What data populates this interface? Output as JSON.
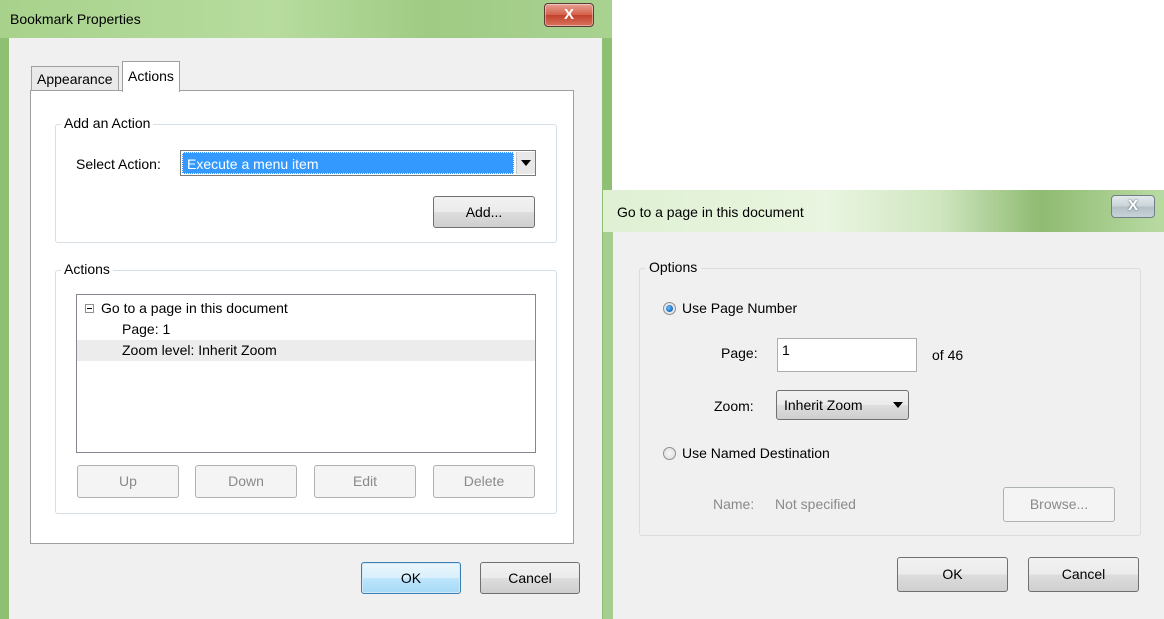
{
  "bookmark_dialog": {
    "title": "Bookmark Properties",
    "close_glyph": "X",
    "tabs": [
      {
        "label": "Appearance",
        "active": false
      },
      {
        "label": "Actions",
        "active": true
      }
    ],
    "add_action": {
      "group_label": "Add an Action",
      "select_label": "Select Action:",
      "select_value": "Execute a menu item",
      "add_button": "Add..."
    },
    "actions": {
      "group_label": "Actions",
      "tree": {
        "root": "Go to a page in this document",
        "page": "Page: 1",
        "zoom": "Zoom level: Inherit Zoom"
      },
      "buttons": {
        "up": "Up",
        "down": "Down",
        "edit": "Edit",
        "delete": "Delete"
      }
    },
    "ok": "OK",
    "cancel": "Cancel"
  },
  "goto_dialog": {
    "title": "Go to a page in this document",
    "close_glyph": "X",
    "options_label": "Options",
    "use_page_number": "Use Page Number",
    "page_label": "Page:",
    "page_value": "1",
    "page_of": "of 46",
    "zoom_label": "Zoom:",
    "zoom_value": "Inherit Zoom",
    "use_named_destination": "Use Named Destination",
    "name_label": "Name:",
    "name_value": "Not specified",
    "browse": "Browse...",
    "ok": "OK",
    "cancel": "Cancel",
    "selected_option": "use_page_number"
  },
  "colors": {
    "selection": "#3399ff",
    "window_frame": "#a6cf8f",
    "client_bg": "#f0f0f0",
    "row_highlight": "#ececec"
  }
}
